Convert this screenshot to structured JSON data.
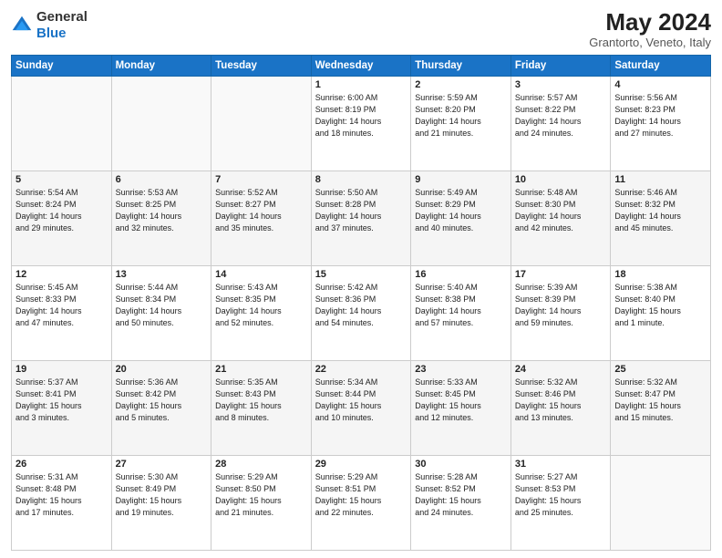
{
  "header": {
    "logo_general": "General",
    "logo_blue": "Blue",
    "month_year": "May 2024",
    "location": "Grantorto, Veneto, Italy"
  },
  "days_of_week": [
    "Sunday",
    "Monday",
    "Tuesday",
    "Wednesday",
    "Thursday",
    "Friday",
    "Saturday"
  ],
  "weeks": [
    [
      {
        "day": "",
        "info": ""
      },
      {
        "day": "",
        "info": ""
      },
      {
        "day": "",
        "info": ""
      },
      {
        "day": "1",
        "info": "Sunrise: 6:00 AM\nSunset: 8:19 PM\nDaylight: 14 hours\nand 18 minutes."
      },
      {
        "day": "2",
        "info": "Sunrise: 5:59 AM\nSunset: 8:20 PM\nDaylight: 14 hours\nand 21 minutes."
      },
      {
        "day": "3",
        "info": "Sunrise: 5:57 AM\nSunset: 8:22 PM\nDaylight: 14 hours\nand 24 minutes."
      },
      {
        "day": "4",
        "info": "Sunrise: 5:56 AM\nSunset: 8:23 PM\nDaylight: 14 hours\nand 27 minutes."
      }
    ],
    [
      {
        "day": "5",
        "info": "Sunrise: 5:54 AM\nSunset: 8:24 PM\nDaylight: 14 hours\nand 29 minutes."
      },
      {
        "day": "6",
        "info": "Sunrise: 5:53 AM\nSunset: 8:25 PM\nDaylight: 14 hours\nand 32 minutes."
      },
      {
        "day": "7",
        "info": "Sunrise: 5:52 AM\nSunset: 8:27 PM\nDaylight: 14 hours\nand 35 minutes."
      },
      {
        "day": "8",
        "info": "Sunrise: 5:50 AM\nSunset: 8:28 PM\nDaylight: 14 hours\nand 37 minutes."
      },
      {
        "day": "9",
        "info": "Sunrise: 5:49 AM\nSunset: 8:29 PM\nDaylight: 14 hours\nand 40 minutes."
      },
      {
        "day": "10",
        "info": "Sunrise: 5:48 AM\nSunset: 8:30 PM\nDaylight: 14 hours\nand 42 minutes."
      },
      {
        "day": "11",
        "info": "Sunrise: 5:46 AM\nSunset: 8:32 PM\nDaylight: 14 hours\nand 45 minutes."
      }
    ],
    [
      {
        "day": "12",
        "info": "Sunrise: 5:45 AM\nSunset: 8:33 PM\nDaylight: 14 hours\nand 47 minutes."
      },
      {
        "day": "13",
        "info": "Sunrise: 5:44 AM\nSunset: 8:34 PM\nDaylight: 14 hours\nand 50 minutes."
      },
      {
        "day": "14",
        "info": "Sunrise: 5:43 AM\nSunset: 8:35 PM\nDaylight: 14 hours\nand 52 minutes."
      },
      {
        "day": "15",
        "info": "Sunrise: 5:42 AM\nSunset: 8:36 PM\nDaylight: 14 hours\nand 54 minutes."
      },
      {
        "day": "16",
        "info": "Sunrise: 5:40 AM\nSunset: 8:38 PM\nDaylight: 14 hours\nand 57 minutes."
      },
      {
        "day": "17",
        "info": "Sunrise: 5:39 AM\nSunset: 8:39 PM\nDaylight: 14 hours\nand 59 minutes."
      },
      {
        "day": "18",
        "info": "Sunrise: 5:38 AM\nSunset: 8:40 PM\nDaylight: 15 hours\nand 1 minute."
      }
    ],
    [
      {
        "day": "19",
        "info": "Sunrise: 5:37 AM\nSunset: 8:41 PM\nDaylight: 15 hours\nand 3 minutes."
      },
      {
        "day": "20",
        "info": "Sunrise: 5:36 AM\nSunset: 8:42 PM\nDaylight: 15 hours\nand 5 minutes."
      },
      {
        "day": "21",
        "info": "Sunrise: 5:35 AM\nSunset: 8:43 PM\nDaylight: 15 hours\nand 8 minutes."
      },
      {
        "day": "22",
        "info": "Sunrise: 5:34 AM\nSunset: 8:44 PM\nDaylight: 15 hours\nand 10 minutes."
      },
      {
        "day": "23",
        "info": "Sunrise: 5:33 AM\nSunset: 8:45 PM\nDaylight: 15 hours\nand 12 minutes."
      },
      {
        "day": "24",
        "info": "Sunrise: 5:32 AM\nSunset: 8:46 PM\nDaylight: 15 hours\nand 13 minutes."
      },
      {
        "day": "25",
        "info": "Sunrise: 5:32 AM\nSunset: 8:47 PM\nDaylight: 15 hours\nand 15 minutes."
      }
    ],
    [
      {
        "day": "26",
        "info": "Sunrise: 5:31 AM\nSunset: 8:48 PM\nDaylight: 15 hours\nand 17 minutes."
      },
      {
        "day": "27",
        "info": "Sunrise: 5:30 AM\nSunset: 8:49 PM\nDaylight: 15 hours\nand 19 minutes."
      },
      {
        "day": "28",
        "info": "Sunrise: 5:29 AM\nSunset: 8:50 PM\nDaylight: 15 hours\nand 21 minutes."
      },
      {
        "day": "29",
        "info": "Sunrise: 5:29 AM\nSunset: 8:51 PM\nDaylight: 15 hours\nand 22 minutes."
      },
      {
        "day": "30",
        "info": "Sunrise: 5:28 AM\nSunset: 8:52 PM\nDaylight: 15 hours\nand 24 minutes."
      },
      {
        "day": "31",
        "info": "Sunrise: 5:27 AM\nSunset: 8:53 PM\nDaylight: 15 hours\nand 25 minutes."
      },
      {
        "day": "",
        "info": ""
      }
    ]
  ]
}
